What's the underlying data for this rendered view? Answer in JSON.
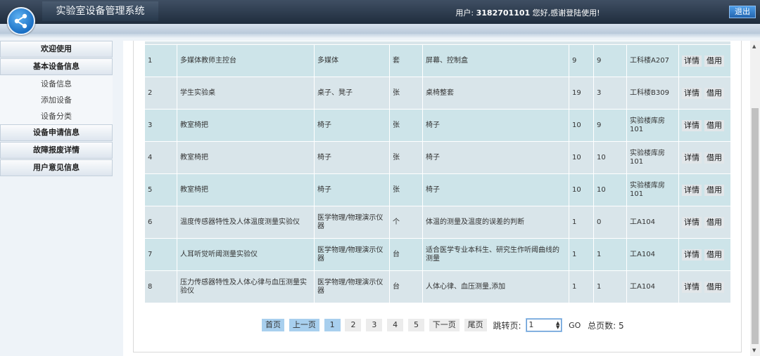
{
  "header": {
    "app_title": "实验室设备管理系统",
    "user_prefix": "用户:",
    "user_id": "3182701101",
    "user_suffix": "您好,感谢登陆使用!",
    "logout_label": "退出"
  },
  "sidebar": {
    "welcome": "欢迎使用",
    "basic_info": "基本设备信息",
    "sub_items": [
      "设备信息",
      "添加设备",
      "设备分类"
    ],
    "apply_info": "设备申请信息",
    "fault_info": "故障报废详情",
    "feedback_info": "用户意见信息"
  },
  "table": {
    "rows": [
      {
        "no": "1",
        "name": "多媒体教师主控台",
        "category": "多媒体",
        "unit": "套",
        "desc": "屏幕、控制盒",
        "total": "9",
        "avail": "9",
        "location": "工科楼A207"
      },
      {
        "no": "2",
        "name": "学生实验桌",
        "category": "桌子、凳子",
        "unit": "张",
        "desc": "桌椅整套",
        "total": "19",
        "avail": "3",
        "location": "工科楼B309"
      },
      {
        "no": "3",
        "name": "教室椅把",
        "category": "椅子",
        "unit": "张",
        "desc": "椅子",
        "total": "10",
        "avail": "9",
        "location": "实验楼库房101"
      },
      {
        "no": "4",
        "name": "教室椅把",
        "category": "椅子",
        "unit": "张",
        "desc": "椅子",
        "total": "10",
        "avail": "10",
        "location": "实验楼库房101"
      },
      {
        "no": "5",
        "name": "教室椅把",
        "category": "椅子",
        "unit": "张",
        "desc": "椅子",
        "total": "10",
        "avail": "10",
        "location": "实验楼库房101"
      },
      {
        "no": "6",
        "name": "温度传感器特性及人体温度测量实验仪",
        "category": "医学物理/物理演示仪器",
        "unit": "个",
        "desc": "体温的测量及温度的误差的判断",
        "total": "1",
        "avail": "0",
        "location": "工A104"
      },
      {
        "no": "7",
        "name": "人耳听觉听阈测量实验仪",
        "category": "医学物理/物理演示仪器",
        "unit": "台",
        "desc": "适合医学专业本科生、研究生作听阈曲线的测量",
        "total": "1",
        "avail": "1",
        "location": "工A104"
      },
      {
        "no": "8",
        "name": "压力传感器特性及人体心律与血压测量实验仪",
        "category": "医学物理/物理演示仪器",
        "unit": "台",
        "desc": "人体心律、血压测量,添加",
        "total": "1",
        "avail": "1",
        "location": "工A104"
      }
    ],
    "detail_label": "详情",
    "borrow_label": "借用"
  },
  "pager": {
    "first": "首页",
    "prev": "上一页",
    "pages": [
      "1",
      "2",
      "3",
      "4",
      "5"
    ],
    "next": "下一页",
    "last": "尾页",
    "jump_label": "跳转页:",
    "jump_value": "1",
    "go": "GO",
    "total_label": "总页数:",
    "total_pages": "5"
  },
  "colors": {
    "header_dark": "#1f2d3d",
    "row_odd": "#cde4e9",
    "row_even": "#d9e5ea",
    "pager_blue": "#a8cfee"
  }
}
